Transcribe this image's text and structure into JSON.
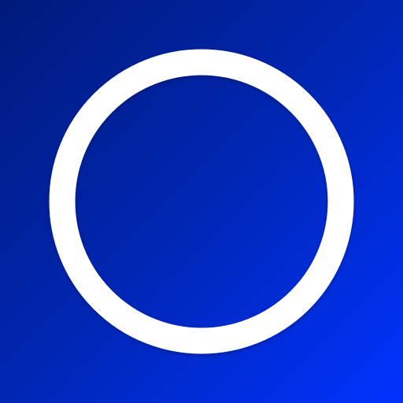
{
  "icon": {
    "name": "ring-icon",
    "colors": {
      "background_start": "#001a7a",
      "background_mid": "#0026b3",
      "background_end": "#0033ff",
      "ring": "#ffffff"
    }
  }
}
